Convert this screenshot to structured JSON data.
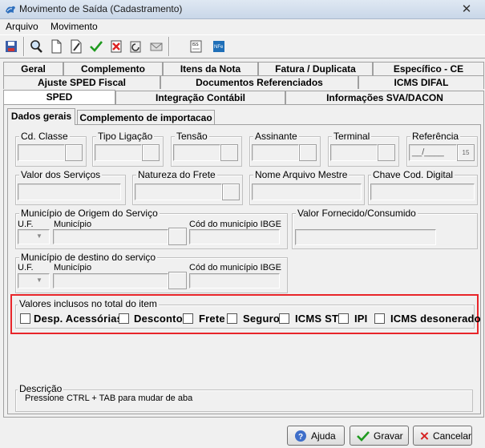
{
  "window": {
    "title": "Movimento de Saída (Cadastramento)",
    "close_glyph": "✕"
  },
  "menu": [
    "Arquivo",
    "Movimento"
  ],
  "toolbar": {
    "icons": [
      "save-icon",
      "search-icon",
      "new-document-icon",
      "edit-icon",
      "confirm-icon",
      "delete-icon",
      "refresh-icon",
      "mail-icon",
      "iss-icon",
      "nfe-icon"
    ]
  },
  "tabs": {
    "row1": [
      "Geral",
      "Complemento",
      "Itens da Nota",
      "Fatura / Duplicata",
      "Específico - CE"
    ],
    "row2": [
      "Ajuste SPED Fiscal",
      "Documentos Referenciados",
      "ICMS DIFAL"
    ],
    "row3": [
      "SPED",
      "Integração Contábil",
      "Informações SVA/DACON"
    ],
    "active": "SPED"
  },
  "subtabs": [
    "Dados gerais",
    "Complemento de importacao"
  ],
  "fields": {
    "cd_classe": "Cd. Classe",
    "tipo_ligacao": "Tipo Ligação",
    "tensao": "Tensão",
    "assinante": "Assinante",
    "terminal": "Terminal",
    "referencia": "Referência",
    "referencia_value": "__/____",
    "referencia_btn": "15",
    "valor_servicos": "Valor dos Serviços",
    "natureza_frete": "Natureza do Frete",
    "nome_arquivo": "Nome Arquivo Mestre",
    "chave_cod": "Chave Cod. Digital",
    "origem_group": "Município de Origem do Serviço",
    "destino_group": "Município de destino do serviço",
    "uf": "U.F.",
    "municipio": "Município",
    "cod_ibge": "Cód do município IBGE",
    "valor_fornecido": "Valor Fornecido/Consumido"
  },
  "valores": {
    "title": "Valores inclusos no total do item",
    "items": [
      "Desp. Acessórias",
      "Desconto",
      "Frete",
      "Seguro",
      "ICMS ST",
      "IPI",
      "ICMS desonerado"
    ],
    "highlight_color": "#e8252a"
  },
  "descricao": {
    "label": "Descrição",
    "text": "Pressione CTRL + TAB para  mudar de aba"
  },
  "buttons": {
    "ajuda": "Ajuda",
    "gravar": "Gravar",
    "cancelar": "Cancelar"
  }
}
